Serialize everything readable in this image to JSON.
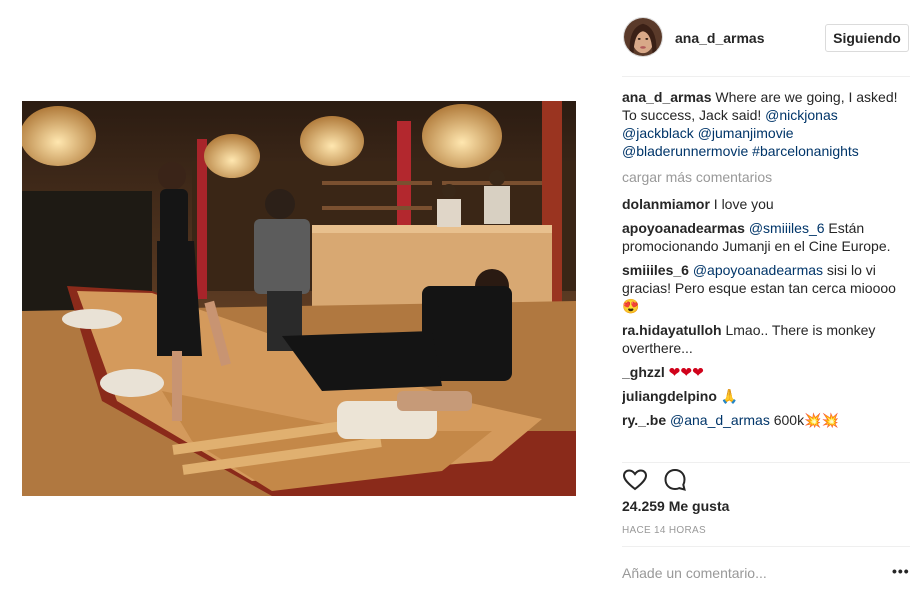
{
  "post": {
    "username": "ana_d_armas",
    "follow_label": "Siguiendo",
    "caption_text": "Where are we going, I asked! To success, Jack said!",
    "caption_tags": [
      "@nickjonas",
      "@jackblack",
      "@jumanjimovie",
      "@bladerunnermovie",
      "#barcelonanights"
    ],
    "load_more": "cargar más comentarios",
    "likes": "24.259 Me gusta",
    "time": "HACE 14 HORAS",
    "comment_placeholder": "Añade un comentario...",
    "more_label": "•••"
  },
  "comments": [
    {
      "user": "dolanmiamor",
      "mention": "",
      "text": "I love you"
    },
    {
      "user": "apoyoanadearmas",
      "mention": "@smiiiles_6",
      "text": "Están promocionando Jumanji en el Cine Europe."
    },
    {
      "user": "smiiiles_6",
      "mention": "@apoyoanadearmas",
      "text": "sisi lo vi gracias! Pero esque estan tan cerca mioooo😍"
    },
    {
      "user": "ra.hidayatulloh",
      "mention": "",
      "text": "Lmao.. There is monkey overthere..."
    },
    {
      "user": "_ghzzl",
      "mention": "",
      "text": "❤❤❤"
    },
    {
      "user": "juliangdelpino",
      "mention": "",
      "text": "🙏"
    },
    {
      "user": "ry._.be",
      "mention": "@ana_d_armas",
      "text": "600k💥💥"
    }
  ],
  "icons": {
    "like": "heart-icon",
    "comment": "comment-bubble-icon"
  },
  "colors": {
    "link": "#003569",
    "muted": "#999999",
    "text": "#262626"
  }
}
